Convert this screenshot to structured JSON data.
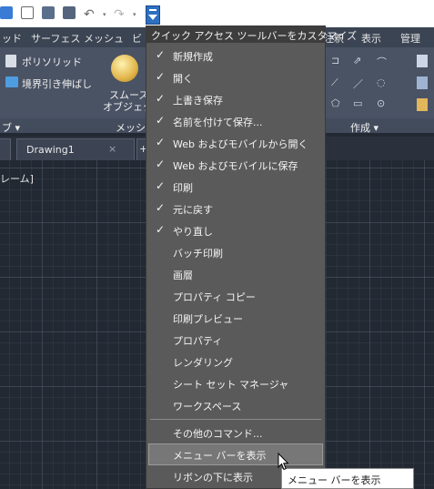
{
  "quick_access": {
    "icons": [
      "workspace-icon",
      "new-icon",
      "open-icon",
      "save-icon",
      "print-icon",
      "undo-icon",
      "redo-icon"
    ],
    "customize_button": "customize-qat-dropdown"
  },
  "ribbon_tabs": [
    "ッド",
    "サーフェス",
    "メッシュ",
    "ビ",
    "注釈",
    "表示",
    "管理"
  ],
  "ribbon": {
    "polysolid_label": "ポリソリッド",
    "extrude_label": "境界引き伸ばし",
    "smooth_object_label_line1": "スムーズ",
    "smooth_object_label_line2": "オブジェクト",
    "panel_labels": {
      "left": "ブ ▾",
      "mesh": "メッシュ",
      "create": "作成 ▾"
    }
  },
  "document_tabs": {
    "active": "Drawing1",
    "close_glyph": "×",
    "new_tab_glyph": "+"
  },
  "canvas": {
    "viewport_label": "レーム]"
  },
  "menu": {
    "title": "クイック アクセス ツールバーをカスタマイズ",
    "items": [
      {
        "label": "新規作成",
        "checked": true
      },
      {
        "label": "開く",
        "checked": true
      },
      {
        "label": "上書き保存",
        "checked": true
      },
      {
        "label": "名前を付けて保存...",
        "checked": true
      },
      {
        "label": "Web およびモバイルから開く",
        "checked": true
      },
      {
        "label": "Web およびモバイルに保存",
        "checked": true
      },
      {
        "label": "印刷",
        "checked": true
      },
      {
        "label": "元に戻す",
        "checked": true
      },
      {
        "label": "やり直し",
        "checked": true
      },
      {
        "label": "バッチ印刷",
        "checked": false
      },
      {
        "label": "画層",
        "checked": false
      },
      {
        "label": "プロパティ コピー",
        "checked": false
      },
      {
        "label": "印刷プレビュー",
        "checked": false
      },
      {
        "label": "プロパティ",
        "checked": false
      },
      {
        "label": "レンダリング",
        "checked": false
      },
      {
        "label": "シート セット マネージャ",
        "checked": false
      },
      {
        "label": "ワークスペース",
        "checked": false
      },
      {
        "label": "その他のコマンド...",
        "checked": false
      },
      {
        "label": "メニュー バーを表示",
        "checked": false
      },
      {
        "label": "リボンの下に表示",
        "checked": false
      }
    ],
    "check_glyph": "✓"
  },
  "tooltip": {
    "text": "メニュー バーを表示"
  },
  "colors": {
    "accent_blue": "#2e6fc0",
    "menu_bg": "#5a5a5a",
    "menu_title_bg": "#3d3d3d",
    "ribbon_bg": "#4a5364",
    "canvas_bg": "#222933"
  }
}
